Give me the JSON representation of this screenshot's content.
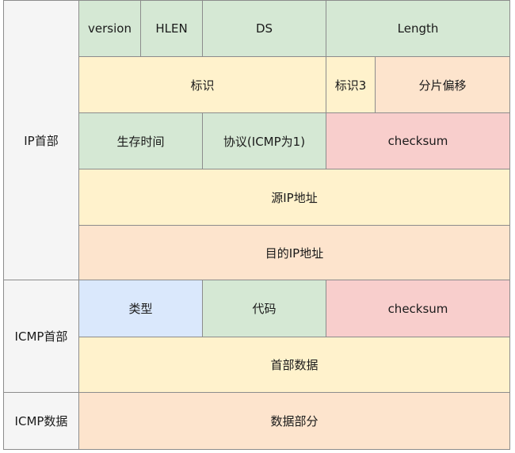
{
  "sections": {
    "ip_header": "IP首部",
    "icmp_header": "ICMP首部",
    "icmp_data": "ICMP数据"
  },
  "ip_header": {
    "row1": {
      "version": "version",
      "hlen": "HLEN",
      "ds": "DS",
      "length": "Length"
    },
    "row2": {
      "identification": "标识",
      "flags": "标识3",
      "fragment_offset": "分片偏移"
    },
    "row3": {
      "ttl": "生存时间",
      "protocol": "协议(ICMP为1)",
      "checksum": "checksum"
    },
    "source_ip": "源IP地址",
    "dest_ip": "目的IP地址"
  },
  "icmp_header": {
    "type": "类型",
    "code": "代码",
    "checksum": "checksum",
    "header_data": "首部数据"
  },
  "icmp_data": {
    "data_part": "数据部分"
  },
  "colors": {
    "label": "#f5f5f5",
    "green": "#d5e8d4",
    "yellow": "#fff2cc",
    "orange": "#fde4cd",
    "red": "#f8cecc",
    "blue": "#dae8fc",
    "border": "#8c8c8c"
  }
}
